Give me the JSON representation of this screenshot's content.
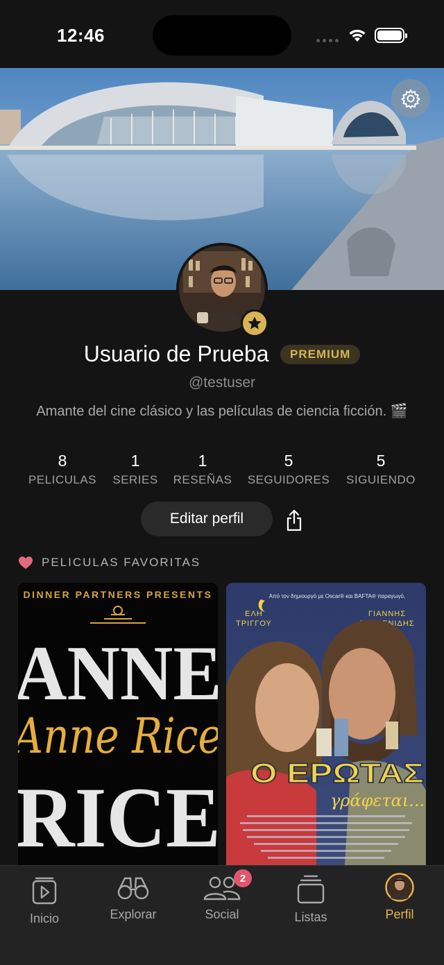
{
  "status_bar": {
    "time": "12:46"
  },
  "profile": {
    "name": "Usuario de Prueba",
    "badge": "PREMIUM",
    "handle": "@testuser",
    "bio": "Amante del cine clásico y las películas de ciencia ficción. 🎬"
  },
  "stats": [
    {
      "value": "8",
      "label": "PELICULAS"
    },
    {
      "value": "1",
      "label": "SERIES"
    },
    {
      "value": "1",
      "label": "RESEÑAS"
    },
    {
      "value": "5",
      "label": "SEGUIDORES"
    },
    {
      "value": "5",
      "label": "SIGUIENDO"
    }
  ],
  "actions": {
    "edit_profile": "Editar perfil"
  },
  "favorites": {
    "title": "PELICULAS FAVORITAS",
    "posters": [
      {
        "presenter": "DINNER PARTNERS PRESENTS",
        "line1": "ANNE",
        "script": "Anne Rice",
        "line2": "RICE"
      },
      {
        "tagline": "Από τον δημιουργό με Oscar® και BAFTA® παραγωγό,",
        "actor_left_1": "ΕΛΗ",
        "actor_left_2": "ΤΡΙΓΓΟΥ",
        "actor_right_1": "ΓΙΑΝΝΗΣ",
        "actor_right_2": "ΠΟΙΜΕΝΙΔΗΣ",
        "title": "Ο ΕΡΩΤΑΣ",
        "subtitle": "γράφεται..."
      }
    ]
  },
  "tab_bar": {
    "tabs": [
      {
        "label": "Inicio",
        "icon": "play-icon"
      },
      {
        "label": "Explorar",
        "icon": "binoculars-icon"
      },
      {
        "label": "Social",
        "icon": "people-icon"
      },
      {
        "label": "Listas",
        "icon": "stack-icon"
      },
      {
        "label": "Perfil",
        "icon": "avatar-icon"
      }
    ],
    "social_badge": "2",
    "active_color": "#e4b54d"
  },
  "colors": {
    "background": "#141414",
    "accent": "#d8b453",
    "badge_red": "#e0566c"
  }
}
